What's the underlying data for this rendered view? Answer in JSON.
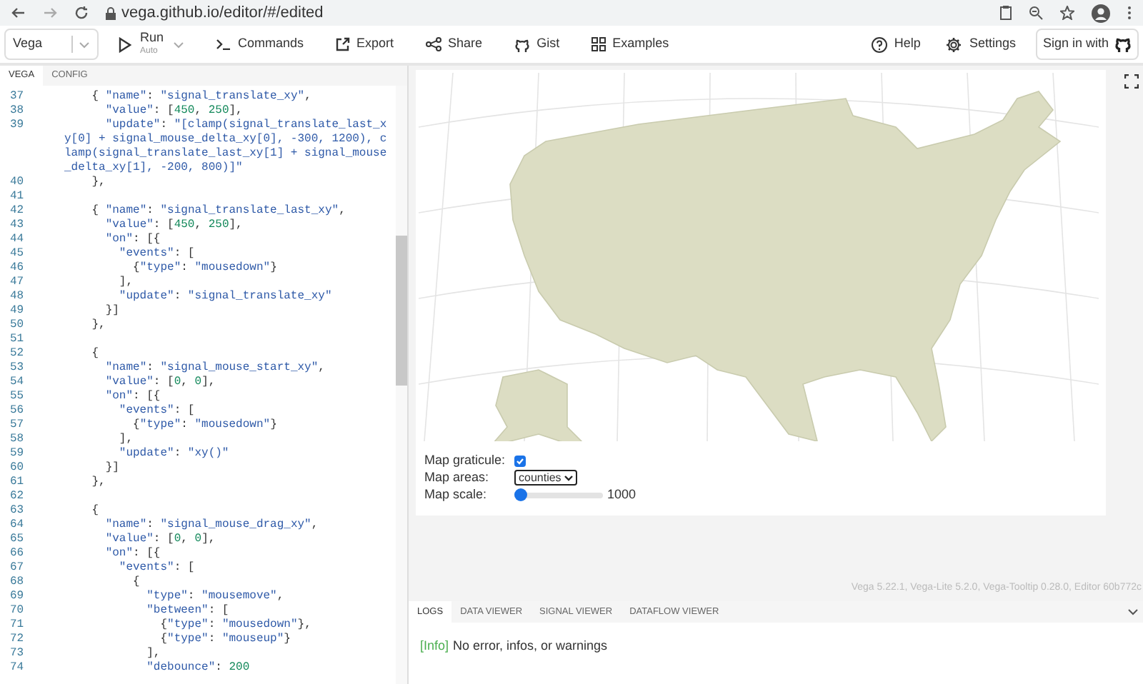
{
  "browser": {
    "url": "vega.github.io/editor/#/edited"
  },
  "toolbar": {
    "mode_select": "Vega",
    "run": {
      "label": "Run",
      "sublabel": "Auto"
    },
    "buttons": [
      {
        "label": "Commands",
        "kind": "commands"
      },
      {
        "label": "Export",
        "kind": "export"
      },
      {
        "label": "Share",
        "kind": "share"
      },
      {
        "label": "Gist",
        "kind": "gist"
      },
      {
        "label": "Examples",
        "kind": "examples"
      }
    ],
    "right_buttons": [
      {
        "label": "Help",
        "kind": "help"
      },
      {
        "label": "Settings",
        "kind": "settings"
      }
    ],
    "sign_in": "Sign in with"
  },
  "editor": {
    "tabs": [
      {
        "label": "VEGA",
        "selected": true
      },
      {
        "label": "CONFIG",
        "selected": false
      }
    ],
    "lines": [
      {
        "number": "37",
        "text": "    { \"name\": \"signal_translate_xy\","
      },
      {
        "number": "38",
        "text": "      \"value\": [450, 250],"
      },
      {
        "number": "39",
        "text": "      \"update\": \"[clamp(signal_translate_last_xy[0] + signal_mouse_delta_xy[0], -300, 1200), clamp(signal_translate_last_xy[1] + signal_mouse_delta_xy[1], -200, 800)]\""
      },
      {
        "number": "40",
        "text": "    },"
      },
      {
        "number": "41"
      },
      {
        "number": "42",
        "text": "    { \"name\": \"signal_translate_last_xy\","
      },
      {
        "number": "43",
        "text": "      \"value\": [450, 250],"
      },
      {
        "number": "44",
        "text": "      \"on\": [{"
      },
      {
        "number": "45",
        "text": "        \"events\": ["
      },
      {
        "number": "46",
        "text": "          {\"type\": \"mousedown\"}"
      },
      {
        "number": "47",
        "text": "        ],"
      },
      {
        "number": "48",
        "text": "        \"update\": \"signal_translate_xy\""
      },
      {
        "number": "49",
        "text": "      }]"
      },
      {
        "number": "50",
        "text": "    },"
      },
      {
        "number": "51"
      },
      {
        "number": "52",
        "text": "    {"
      },
      {
        "number": "53",
        "text": "      \"name\": \"signal_mouse_start_xy\","
      },
      {
        "number": "54",
        "text": "      \"value\": [0, 0],"
      },
      {
        "number": "55",
        "text": "      \"on\": [{"
      },
      {
        "number": "56",
        "text": "        \"events\": ["
      },
      {
        "number": "57",
        "text": "          {\"type\": \"mousedown\"}"
      },
      {
        "number": "58",
        "text": "        ],"
      },
      {
        "number": "59",
        "text": "        \"update\": \"xy()\""
      },
      {
        "number": "60",
        "text": "      }]"
      },
      {
        "number": "61",
        "text": "    },"
      },
      {
        "number": "62"
      },
      {
        "number": "63",
        "text": "    {"
      },
      {
        "number": "64",
        "text": "      \"name\": \"signal_mouse_drag_xy\","
      },
      {
        "number": "65",
        "text": "      \"value\": [0, 0],"
      },
      {
        "number": "66",
        "text": "      \"on\": [{"
      },
      {
        "number": "67",
        "text": "        \"events\": ["
      },
      {
        "number": "68",
        "text": "          {"
      },
      {
        "number": "69",
        "text": "            \"type\": \"mousemove\","
      },
      {
        "number": "70",
        "text": "            \"between\": ["
      },
      {
        "number": "71",
        "text": "              {\"type\": \"mousedown\"},"
      },
      {
        "number": "72",
        "text": "              {\"type\": \"mouseup\"}"
      },
      {
        "number": "73",
        "text": "            ],"
      },
      {
        "number": "74",
        "text": "            \"debounce\": 200"
      }
    ]
  },
  "preview": {
    "controls": [
      {
        "kind": "checkbox",
        "label": "Map graticule:",
        "checked": true
      },
      {
        "kind": "select",
        "label": "Map areas:",
        "value": "counties"
      },
      {
        "kind": "slider",
        "label": "Map scale:",
        "level": 0,
        "reading": "1000"
      }
    ],
    "version": "Vega 5.22.1, Vega-Lite 5.2.0, Vega-Tooltip 0.28.0, Editor 60b772c"
  },
  "logs": {
    "tabs": [
      {
        "label": "LOGS",
        "selected": true
      },
      {
        "label": "DATA VIEWER",
        "selected": false
      },
      {
        "label": "SIGNAL VIEWER",
        "selected": false
      },
      {
        "label": "DATAFLOW VIEWER",
        "selected": false
      }
    ],
    "entries": [
      {
        "level": "[Info]",
        "message": "No error, infos, or warnings"
      }
    ]
  }
}
